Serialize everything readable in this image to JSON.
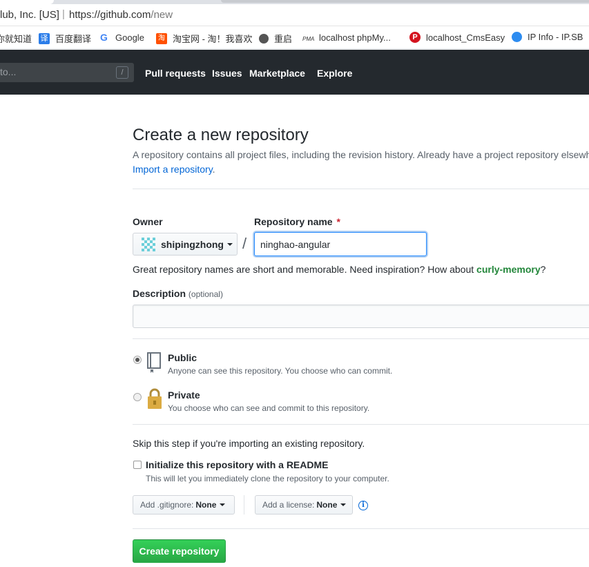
{
  "browser": {
    "org": "lub, Inc. [US]",
    "url_host": "https://github.com",
    "url_path": "/new",
    "bookmarks": [
      {
        "label": "你就知道",
        "icon": "none"
      },
      {
        "label": "百度翻译",
        "icon": "baidu-translate-icon"
      },
      {
        "label": "Google",
        "icon": "google-icon"
      },
      {
        "label": "淘宝网 - 淘！我喜欢",
        "icon": "taobao-icon"
      },
      {
        "label": "重启",
        "icon": "globe-icon"
      },
      {
        "label": "localhost phpMy...",
        "icon": "phpmyadmin-icon"
      },
      {
        "label": "localhost_CmsEasy",
        "icon": "p-icon"
      },
      {
        "label": "IP Info - IP.SB",
        "icon": "ipsb-icon"
      }
    ]
  },
  "header": {
    "search_placeholder": "to...",
    "search_key": "/",
    "nav": [
      "Pull requests",
      "Issues",
      "Marketplace",
      "Explore"
    ]
  },
  "page": {
    "title": "Create a new repository",
    "subtitle": "A repository contains all project files, including the revision history. Already have a project repository elsewh",
    "import_link": "Import a repository",
    "import_dot": ".",
    "owner_label": "Owner",
    "owner_value": "shipingzhong",
    "repo_label": "Repository name",
    "required_mark": "*",
    "repo_value": "ninghao-angular",
    "hint_prefix": "Great repository names are short and memorable. Need inspiration? How about ",
    "hint_suggestion": "curly-memory",
    "hint_suffix": "?",
    "desc_label": "Description",
    "desc_optional": "(optional)",
    "desc_value": "",
    "public_title": "Public",
    "public_desc": "Anyone can see this repository. You choose who can commit.",
    "private_title": "Private",
    "private_desc": "You choose who can see and commit to this repository.",
    "skip_text": "Skip this step if you're importing an existing repository.",
    "init_label": "Initialize this repository with a README",
    "init_note": "This will let you immediately clone the repository to your computer.",
    "gitignore_label": "Add .gitignore:",
    "gitignore_value": "None",
    "license_label": "Add a license:",
    "license_value": "None",
    "info_glyph": "i",
    "create_button": "Create repository"
  },
  "colors": {
    "header_bg": "#24292e",
    "link": "#0366d6",
    "create_button": "#28a745",
    "suggestion": "#22863a",
    "required": "#cb2431"
  },
  "state": {
    "visibility": "public",
    "init_readme": false
  }
}
